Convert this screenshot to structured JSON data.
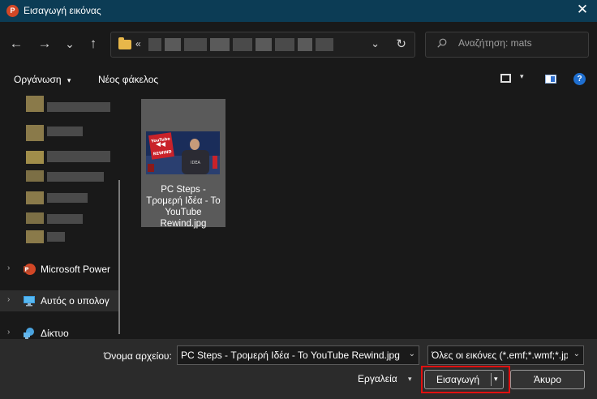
{
  "window": {
    "title": "Εισαγωγή εικόνας",
    "app_icon_letter": "P",
    "close_glyph": "✕"
  },
  "nav": {
    "back_glyph": "←",
    "forward_glyph": "→",
    "recent_glyph": "⌄",
    "up_glyph": "↑",
    "path_prefix": "«",
    "address_dropdown_glyph": "⌄",
    "refresh_glyph": "↻",
    "search_placeholder": "Αναζήτηση: mats"
  },
  "toolbar": {
    "organize_label": "Οργάνωση",
    "organize_dropdown_glyph": "▾",
    "new_folder_label": "Νέος φάκελος",
    "view_dropdown_glyph": "▾",
    "help_glyph": "?"
  },
  "sidebar": {
    "expand_glyph": "›",
    "items": [
      {
        "label": "Microsoft Power",
        "icon": "powerpoint-icon"
      },
      {
        "label": "Αυτός ο υπολογ",
        "icon": "computer-icon"
      },
      {
        "label": "Δίκτυο",
        "icon": "network-icon"
      }
    ]
  },
  "files": [
    {
      "name": "PC Steps - Τρομερή Ιδέα - Το YouTube Rewind.jpg",
      "thumb_label": "YouTube REWIND",
      "thumb_shirt": "IDEA"
    }
  ],
  "footer": {
    "filename_label": "Όνομα αρχείου:",
    "filename_value": "PC Steps - Τρομερή Ιδέα - Το YouTube Rewind.jpg",
    "filetype_value": "Όλες οι εικόνες (*.emf;*.wmf;*.jpg",
    "dropdown_glyph": "⌄",
    "tools_label": "Εργαλεία",
    "tools_dropdown_glyph": "▾",
    "insert_label": "Εισαγωγή",
    "insert_dropdown_glyph": "▾",
    "cancel_label": "Άκυρο"
  },
  "colors": {
    "titlebar": "#0c3c55",
    "highlight": "#e01010",
    "folder": "#e8b74a"
  }
}
